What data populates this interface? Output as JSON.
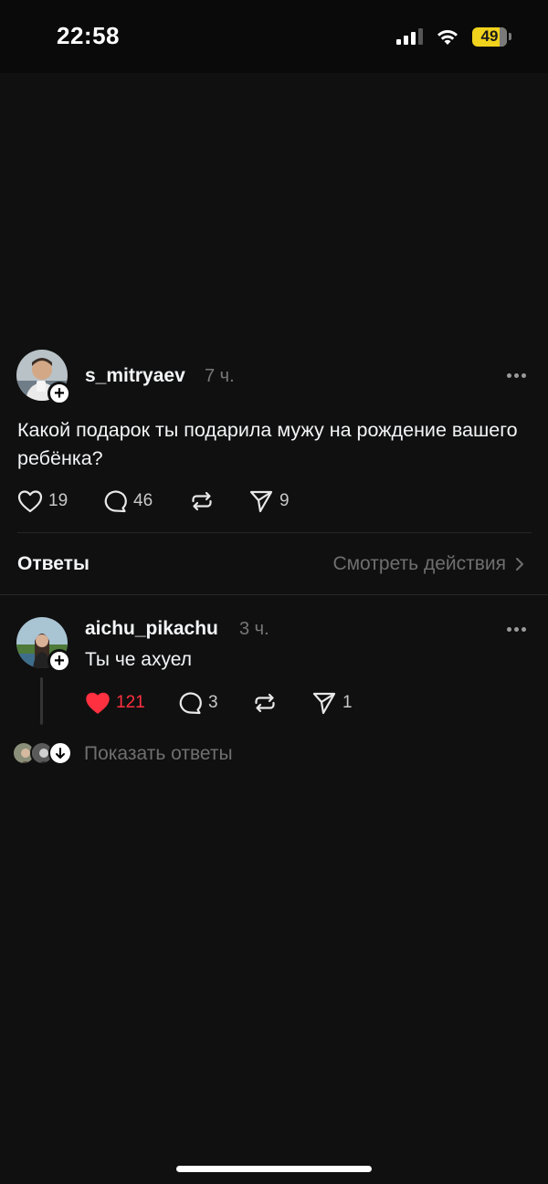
{
  "status_bar": {
    "time": "22:58",
    "battery": "49"
  },
  "post": {
    "username": "s_mitryaev",
    "time": "7 ч.",
    "text": "Какой подарок ты подарила мужу на рождение вашего ребёнка?",
    "likes": "19",
    "comments": "46",
    "shares": "9"
  },
  "replies_header": {
    "title": "Ответы",
    "view_actions": "Смотреть действия"
  },
  "reply": {
    "username": "aichu_pikachu",
    "time": "3 ч.",
    "text": "Ты че ахуел",
    "likes": "121",
    "liked": true,
    "comments": "3",
    "shares": "1",
    "show_replies": "Показать ответы"
  },
  "colors": {
    "background": "#101010",
    "like_active": "#ff3040",
    "muted": "#777777"
  }
}
